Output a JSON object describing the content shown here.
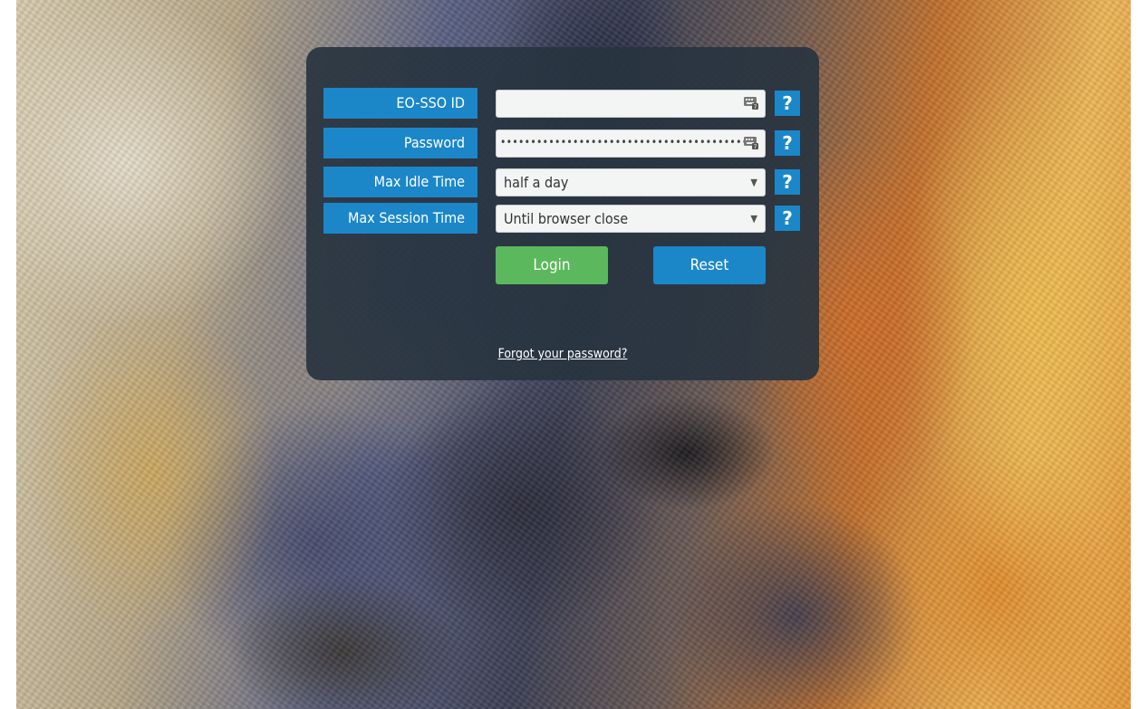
{
  "form": {
    "fields": [
      {
        "label": "EO-SSO ID",
        "value": ""
      },
      {
        "label": "Password",
        "value": "••••••••••••••••••••••••••••••••••••••••••"
      },
      {
        "label": "Max Idle Time",
        "value": "half a day"
      },
      {
        "label": "Max Session Time",
        "value": "Until browser close"
      }
    ],
    "help_symbol": "?",
    "login_label": "Login",
    "reset_label": "Reset",
    "forgot_label": "Forgot your password?"
  },
  "icons": {
    "keyboard": "virtual-keyboard-icon",
    "caret": "▼",
    "help": "help-icon"
  },
  "colors": {
    "label_bg": "#1b87c9",
    "help_bg": "#1b87c9",
    "login_bg": "#5cb85c",
    "reset_bg": "#1b87c9",
    "panel_bg": "#283440"
  }
}
